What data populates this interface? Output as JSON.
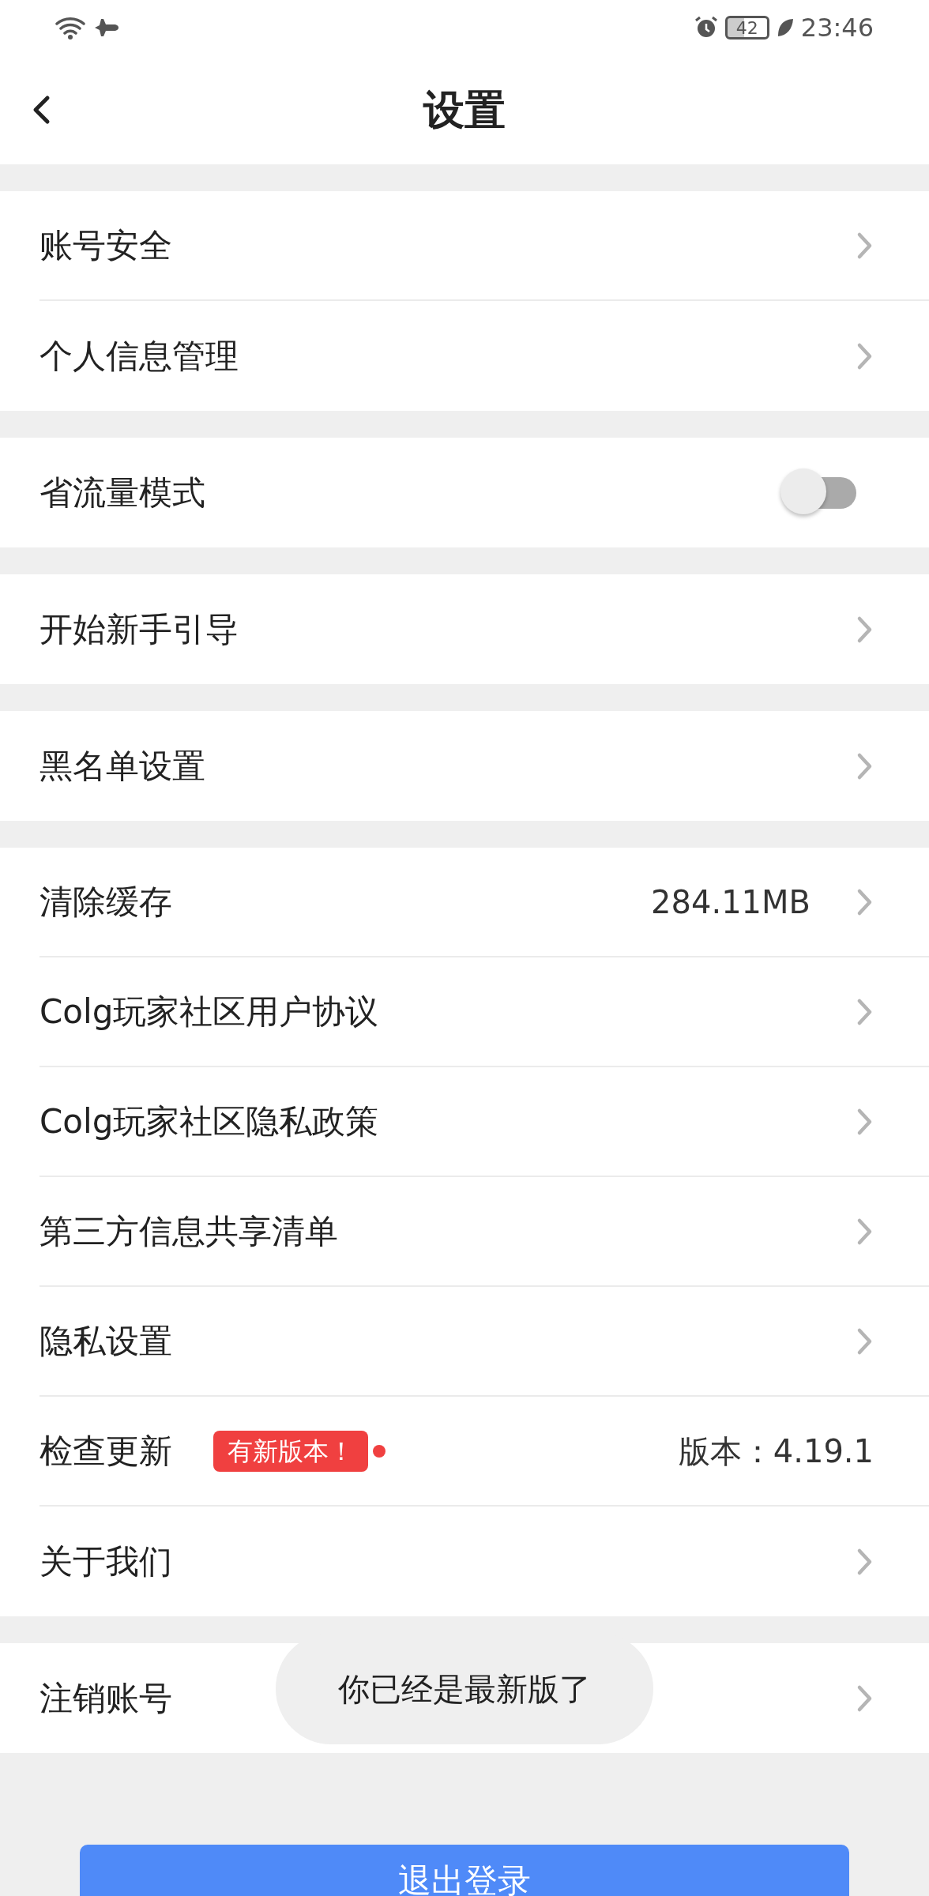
{
  "status_bar": {
    "battery": "42",
    "time": "23:46"
  },
  "header": {
    "title": "设置"
  },
  "groups": [
    {
      "items": [
        {
          "kind": "link",
          "label": "账号安全"
        },
        {
          "kind": "link",
          "label": "个人信息管理"
        }
      ]
    },
    {
      "items": [
        {
          "kind": "toggle",
          "label": "省流量模式",
          "on": false
        }
      ]
    },
    {
      "items": [
        {
          "kind": "link",
          "label": "开始新手引导"
        }
      ]
    },
    {
      "items": [
        {
          "kind": "link",
          "label": "黑名单设置"
        }
      ]
    },
    {
      "items": [
        {
          "kind": "link",
          "label": "清除缓存",
          "value": "284.11MB"
        },
        {
          "kind": "link",
          "label": "Colg玩家社区用户协议"
        },
        {
          "kind": "link",
          "label": "Colg玩家社区隐私政策"
        },
        {
          "kind": "link",
          "label": "第三方信息共享清单"
        },
        {
          "kind": "link",
          "label": "隐私设置"
        },
        {
          "kind": "update",
          "label": "检查更新",
          "badge": "有新版本！",
          "value": "版本：4.19.1"
        },
        {
          "kind": "link",
          "label": "关于我们"
        }
      ]
    },
    {
      "items": [
        {
          "kind": "link",
          "label": "注销账号"
        }
      ]
    }
  ],
  "toast": "你已经是最新版了",
  "logout_button": "退出登录"
}
